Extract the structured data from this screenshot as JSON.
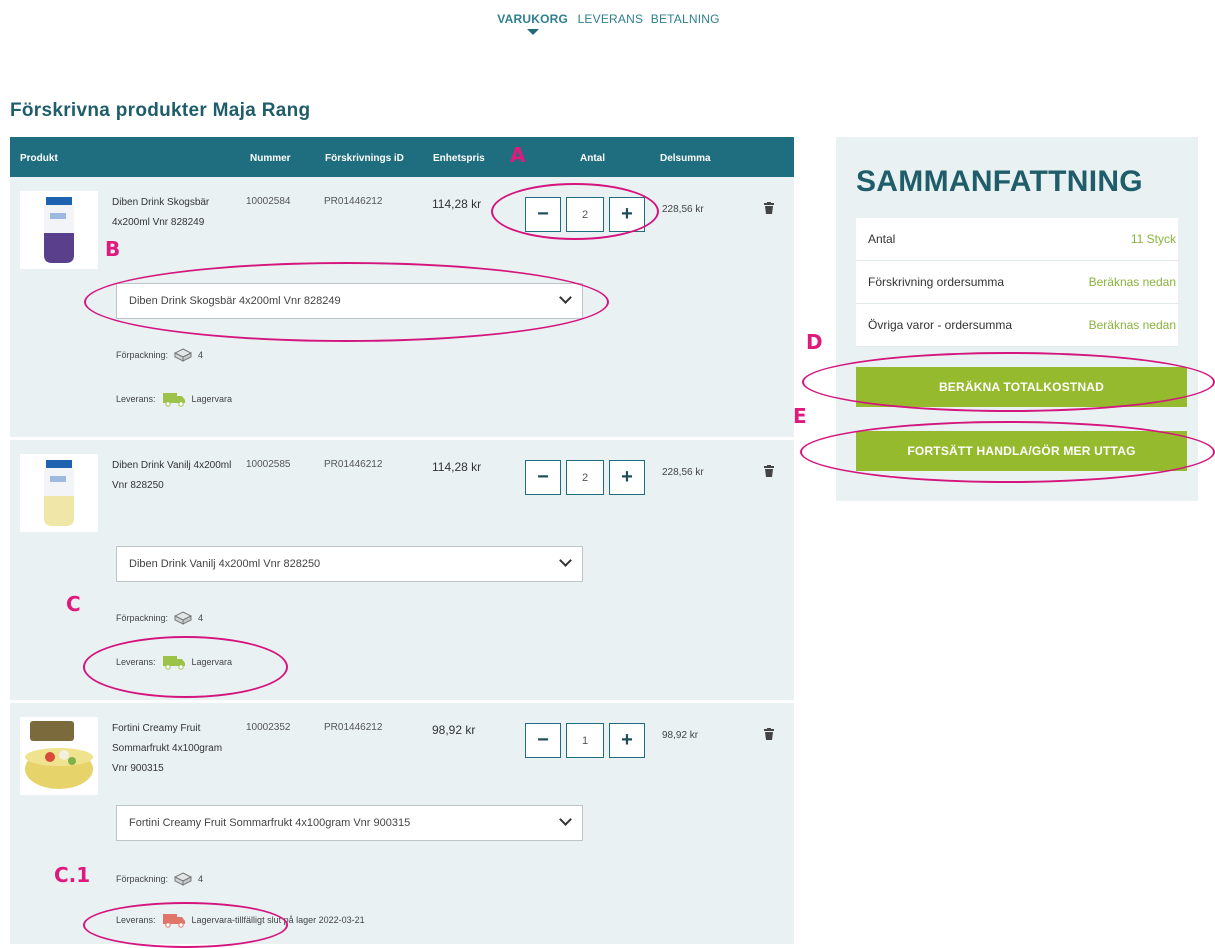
{
  "steps": {
    "cart": "VARUKORG",
    "delivery": "LEVERANS",
    "payment": "BETALNING"
  },
  "page_title": "Förskrivna produkter Maja Rang",
  "table_headers": {
    "product": "Produkt",
    "number": "Nummer",
    "prescription_id": "Förskrivnings iD",
    "unit_price": "Enhetspris",
    "quantity": "Antal",
    "subtotal": "Delsumma"
  },
  "labels": {
    "packaging": "Förpackning:",
    "delivery": "Leverans:"
  },
  "products": [
    {
      "name": "Diben Drink Skogsbär 4x200ml Vnr 828249",
      "number": "10002584",
      "prescription_id": "PR01446212",
      "unit_price": "114,28 kr",
      "quantity": "2",
      "subtotal": "228,56 kr",
      "variant": "Diben Drink Skogsbär 4x200ml Vnr 828249",
      "packaging": "4",
      "delivery_status": "Lagervara",
      "delivery_color": "#9cc24a"
    },
    {
      "name": "Diben Drink Vanilj 4x200ml Vnr 828250",
      "number": "10002585",
      "prescription_id": "PR01446212",
      "unit_price": "114,28 kr",
      "quantity": "2",
      "subtotal": "228,56 kr",
      "variant": "Diben Drink Vanilj 4x200ml Vnr 828250",
      "packaging": "4",
      "delivery_status": "Lagervara",
      "delivery_color": "#9cc24a"
    },
    {
      "name": "Fortini Creamy Fruit Sommarfrukt 4x100gram Vnr 900315",
      "number": "10002352",
      "prescription_id": "PR01446212",
      "unit_price": "98,92 kr",
      "quantity": "1",
      "subtotal": "98,92 kr",
      "variant": "Fortini Creamy Fruit Sommarfrukt 4x100gram Vnr 900315",
      "packaging": "4",
      "delivery_status": "Lagervara-tillfälligt slut på lager  2022-03-21",
      "delivery_color": "#e0766a"
    }
  ],
  "icons": {
    "minus": "−",
    "plus": "+",
    "trash": "trash-icon"
  },
  "summary": {
    "title": "SAMMANFATTNING",
    "rows": [
      {
        "label": "Antal",
        "value": "11 Styck"
      },
      {
        "label": "Förskrivning ordersumma",
        "value": "Beräknas nedan"
      },
      {
        "label": "Övriga varor - ordersumma",
        "value": "Beräknas nedan"
      }
    ],
    "calc_button": "BERÄKNA TOTALKOSTNAD",
    "continue_button": "FORTSÄTT HANDLA/GÖR MER UTTAG"
  },
  "annotations": {
    "a": "A",
    "b": "B",
    "c": "C",
    "c1": "C.1",
    "d": "D",
    "e": "E"
  },
  "colors": {
    "header": "#1e6e7f",
    "accent_green": "#96ba2e",
    "annotation": "#e0197d"
  }
}
